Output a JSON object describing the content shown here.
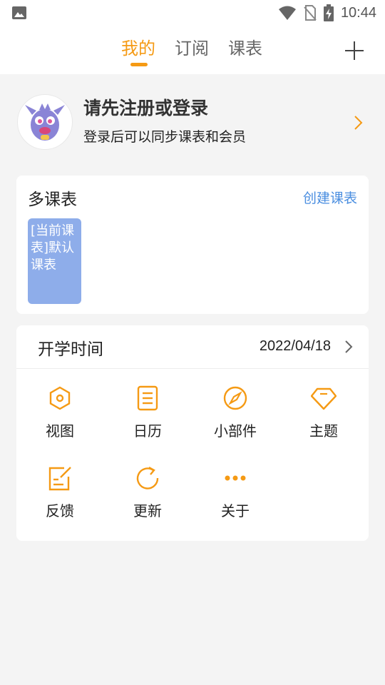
{
  "status_bar": {
    "time": "10:44",
    "icons": [
      "image-icon",
      "wifi-icon",
      "no-sim-icon",
      "battery-charging-icon"
    ]
  },
  "tabs": [
    {
      "label": "我的",
      "active": true
    },
    {
      "label": "订阅",
      "active": false
    },
    {
      "label": "课表",
      "active": false
    }
  ],
  "header": {
    "add_icon": "plus-icon"
  },
  "profile": {
    "title": "请先注册或登录",
    "subtitle": "登录后可以同步课表和会员"
  },
  "multi_schedule": {
    "title": "多课表",
    "create_label": "创建课表",
    "tiles": [
      {
        "text": "[当前课表]默认课表",
        "color": "#8eadea"
      }
    ]
  },
  "semester": {
    "label": "开学时间",
    "date": "2022/04/18"
  },
  "menu": [
    {
      "label": "视图",
      "icon": "hexagon-icon"
    },
    {
      "label": "日历",
      "icon": "document-icon"
    },
    {
      "label": "小部件",
      "icon": "compass-icon"
    },
    {
      "label": "主题",
      "icon": "diamond-icon"
    },
    {
      "label": "反馈",
      "icon": "edit-note-icon"
    },
    {
      "label": "更新",
      "icon": "refresh-icon"
    },
    {
      "label": "关于",
      "icon": "more-dots-icon"
    }
  ],
  "colors": {
    "accent": "#f59a14",
    "link": "#4a8ee0",
    "tile": "#8eadea",
    "background": "#f4f4f4"
  }
}
